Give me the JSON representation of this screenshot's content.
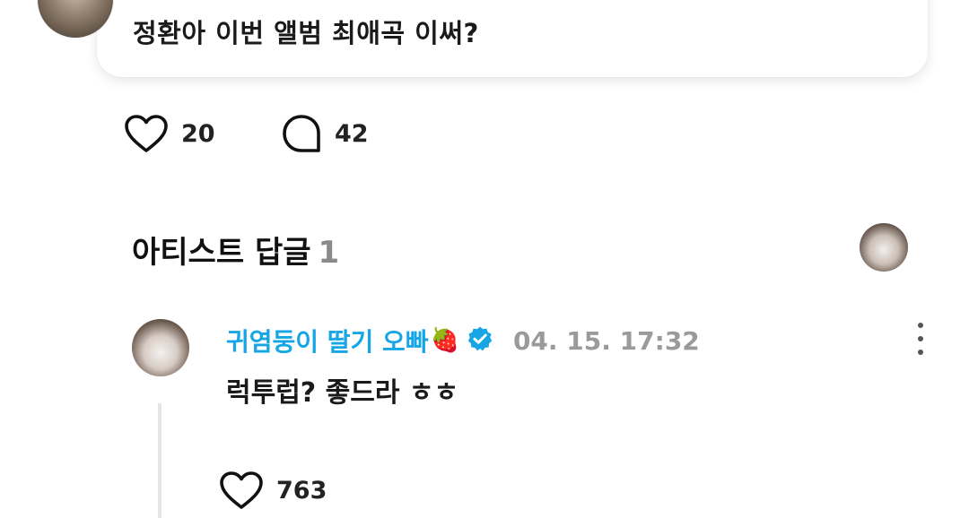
{
  "post": {
    "text": "정환아 이번 앨범 최애곡 이써?",
    "likes": "20",
    "comments": "42"
  },
  "artist_replies": {
    "title": "아티스트 답글",
    "count": "1"
  },
  "reply": {
    "author": "귀염둥이 딸기 오빠",
    "emoji": "🍓",
    "timestamp": "04. 15. 17:32",
    "text": "럭투럽? 좋드라 ㅎㅎ",
    "likes": "763"
  },
  "icons": {
    "like": "heart-outline-icon",
    "comment": "speech-bubble-icon",
    "verified": "verified-check-icon",
    "more": "more-vertical-icon"
  },
  "colors": {
    "author_name": "#16a6e6",
    "verified_badge": "#16a6e6",
    "muted_text": "#9a9a9a"
  }
}
